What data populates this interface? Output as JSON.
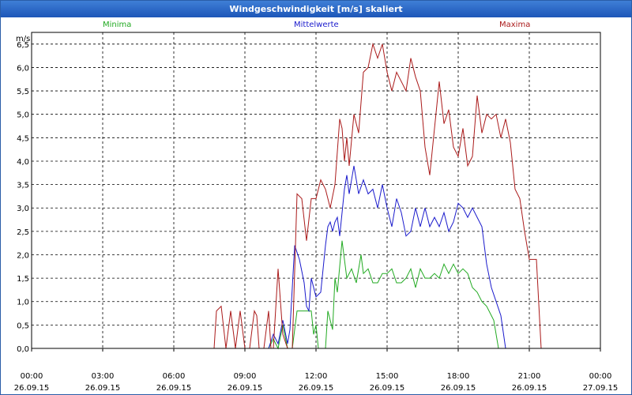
{
  "window": {
    "title": "Windgeschwindigkeit [m/s] skaliert"
  },
  "chart_data": {
    "type": "line",
    "title": "Windgeschwindigkeit [m/s] skaliert",
    "ylabel": "m/s",
    "xlabel": "",
    "ylim": [
      0,
      6.75
    ],
    "xlim": [
      0,
      24
    ],
    "grid": true,
    "legend_position": "top",
    "yticks": [
      "0,0",
      "0,5",
      "1,0",
      "1,5",
      "2,0",
      "2,5",
      "3,0",
      "3,5",
      "4,0",
      "4,5",
      "5,0",
      "5,5",
      "6,0",
      "6,5"
    ],
    "xticks": [
      {
        "time": "00:00",
        "date": "26.09.15"
      },
      {
        "time": "03:00",
        "date": "26.09.15"
      },
      {
        "time": "06:00",
        "date": "26.09.15"
      },
      {
        "time": "09:00",
        "date": "26.09.15"
      },
      {
        "time": "12:00",
        "date": "26.09.15"
      },
      {
        "time": "15:00",
        "date": "26.09.15"
      },
      {
        "time": "18:00",
        "date": "26.09.15"
      },
      {
        "time": "21:00",
        "date": "26.09.15"
      },
      {
        "time": "00:00",
        "date": "27.09.15"
      }
    ],
    "series": [
      {
        "name": "Minima",
        "color": "#22aa22",
        "points": [
          [
            0,
            0
          ],
          [
            10.0,
            0
          ],
          [
            10.2,
            0.2
          ],
          [
            10.4,
            0
          ],
          [
            10.6,
            0.5
          ],
          [
            10.8,
            0
          ],
          [
            11.0,
            0
          ],
          [
            11.2,
            0.8
          ],
          [
            11.5,
            0.8
          ],
          [
            11.8,
            0.8
          ],
          [
            11.9,
            0.3
          ],
          [
            12.0,
            0.5
          ],
          [
            12.1,
            0
          ],
          [
            12.4,
            0
          ],
          [
            12.5,
            0.8
          ],
          [
            12.7,
            0.4
          ],
          [
            12.8,
            1.5
          ],
          [
            12.9,
            1.2
          ],
          [
            13.1,
            2.3
          ],
          [
            13.2,
            1.9
          ],
          [
            13.3,
            1.5
          ],
          [
            13.5,
            1.7
          ],
          [
            13.7,
            1.4
          ],
          [
            13.9,
            2.0
          ],
          [
            14.0,
            1.6
          ],
          [
            14.2,
            1.7
          ],
          [
            14.4,
            1.4
          ],
          [
            14.6,
            1.4
          ],
          [
            14.8,
            1.6
          ],
          [
            15.0,
            1.6
          ],
          [
            15.2,
            1.7
          ],
          [
            15.4,
            1.4
          ],
          [
            15.6,
            1.4
          ],
          [
            15.8,
            1.5
          ],
          [
            16.0,
            1.7
          ],
          [
            16.2,
            1.3
          ],
          [
            16.4,
            1.7
          ],
          [
            16.6,
            1.5
          ],
          [
            16.8,
            1.5
          ],
          [
            17.0,
            1.6
          ],
          [
            17.2,
            1.5
          ],
          [
            17.4,
            1.8
          ],
          [
            17.6,
            1.6
          ],
          [
            17.8,
            1.8
          ],
          [
            18.0,
            1.6
          ],
          [
            18.2,
            1.7
          ],
          [
            18.4,
            1.6
          ],
          [
            18.6,
            1.3
          ],
          [
            18.8,
            1.2
          ],
          [
            19.0,
            1.0
          ],
          [
            19.2,
            0.9
          ],
          [
            19.4,
            0.7
          ],
          [
            19.5,
            0.6
          ],
          [
            19.7,
            0
          ],
          [
            24,
            0
          ]
        ]
      },
      {
        "name": "Mittelwerte",
        "color": "#1a1acc",
        "points": [
          [
            0,
            0
          ],
          [
            10.0,
            0
          ],
          [
            10.2,
            0.3
          ],
          [
            10.4,
            0.1
          ],
          [
            10.6,
            0.6
          ],
          [
            10.8,
            0.1
          ],
          [
            10.9,
            0.4
          ],
          [
            11.1,
            2.2
          ],
          [
            11.3,
            1.9
          ],
          [
            11.5,
            1.4
          ],
          [
            11.6,
            0.9
          ],
          [
            11.7,
            0.8
          ],
          [
            11.8,
            1.5
          ],
          [
            12.0,
            1.1
          ],
          [
            12.2,
            1.2
          ],
          [
            12.4,
            2.2
          ],
          [
            12.5,
            2.6
          ],
          [
            12.6,
            2.7
          ],
          [
            12.7,
            2.5
          ],
          [
            12.8,
            2.7
          ],
          [
            12.9,
            2.8
          ],
          [
            13.0,
            2.4
          ],
          [
            13.2,
            3.4
          ],
          [
            13.3,
            3.7
          ],
          [
            13.4,
            3.3
          ],
          [
            13.6,
            3.9
          ],
          [
            13.8,
            3.3
          ],
          [
            14.0,
            3.6
          ],
          [
            14.2,
            3.3
          ],
          [
            14.4,
            3.4
          ],
          [
            14.6,
            3.0
          ],
          [
            14.8,
            3.5
          ],
          [
            15.0,
            3.0
          ],
          [
            15.2,
            2.6
          ],
          [
            15.4,
            3.2
          ],
          [
            15.6,
            2.9
          ],
          [
            15.8,
            2.4
          ],
          [
            16.0,
            2.5
          ],
          [
            16.2,
            3.0
          ],
          [
            16.4,
            2.6
          ],
          [
            16.6,
            3.0
          ],
          [
            16.8,
            2.6
          ],
          [
            17.0,
            2.8
          ],
          [
            17.2,
            2.6
          ],
          [
            17.4,
            2.9
          ],
          [
            17.6,
            2.5
          ],
          [
            17.8,
            2.7
          ],
          [
            18.0,
            3.1
          ],
          [
            18.2,
            3.0
          ],
          [
            18.4,
            2.8
          ],
          [
            18.6,
            3.0
          ],
          [
            18.8,
            2.8
          ],
          [
            19.0,
            2.6
          ],
          [
            19.2,
            1.8
          ],
          [
            19.4,
            1.3
          ],
          [
            19.6,
            1.0
          ],
          [
            19.8,
            0.7
          ],
          [
            20.0,
            0
          ],
          [
            24,
            0
          ]
        ]
      },
      {
        "name": "Maxima",
        "color": "#aa1a1a",
        "points": [
          [
            0,
            0
          ],
          [
            7.7,
            0
          ],
          [
            7.8,
            0.8
          ],
          [
            8.0,
            0.9
          ],
          [
            8.2,
            0
          ],
          [
            8.4,
            0.8
          ],
          [
            8.6,
            0
          ],
          [
            8.8,
            0.8
          ],
          [
            9.0,
            0
          ],
          [
            9.2,
            0
          ],
          [
            9.4,
            0.8
          ],
          [
            9.5,
            0.7
          ],
          [
            9.6,
            0
          ],
          [
            9.8,
            0
          ],
          [
            10.0,
            0.8
          ],
          [
            10.1,
            0
          ],
          [
            10.2,
            0
          ],
          [
            10.4,
            1.7
          ],
          [
            10.5,
            1.0
          ],
          [
            10.6,
            0.3
          ],
          [
            10.8,
            0
          ],
          [
            11.0,
            0
          ],
          [
            11.2,
            3.3
          ],
          [
            11.4,
            3.2
          ],
          [
            11.6,
            2.3
          ],
          [
            11.8,
            3.2
          ],
          [
            12.0,
            3.2
          ],
          [
            12.2,
            3.6
          ],
          [
            12.4,
            3.4
          ],
          [
            12.6,
            3.0
          ],
          [
            12.8,
            3.5
          ],
          [
            13.0,
            4.9
          ],
          [
            13.1,
            4.7
          ],
          [
            13.2,
            4.0
          ],
          [
            13.3,
            4.5
          ],
          [
            13.4,
            3.9
          ],
          [
            13.6,
            5.0
          ],
          [
            13.8,
            4.6
          ],
          [
            14.0,
            5.9
          ],
          [
            14.2,
            6.0
          ],
          [
            14.4,
            6.5
          ],
          [
            14.6,
            6.2
          ],
          [
            14.8,
            6.5
          ],
          [
            15.0,
            5.9
          ],
          [
            15.2,
            5.5
          ],
          [
            15.4,
            5.9
          ],
          [
            15.6,
            5.7
          ],
          [
            15.8,
            5.5
          ],
          [
            16.0,
            6.2
          ],
          [
            16.2,
            5.8
          ],
          [
            16.4,
            5.5
          ],
          [
            16.6,
            4.3
          ],
          [
            16.8,
            3.7
          ],
          [
            17.0,
            4.7
          ],
          [
            17.2,
            5.7
          ],
          [
            17.4,
            4.8
          ],
          [
            17.6,
            5.1
          ],
          [
            17.8,
            4.3
          ],
          [
            18.0,
            4.1
          ],
          [
            18.2,
            4.7
          ],
          [
            18.4,
            3.9
          ],
          [
            18.6,
            4.1
          ],
          [
            18.8,
            5.4
          ],
          [
            19.0,
            4.6
          ],
          [
            19.2,
            5.0
          ],
          [
            19.4,
            4.9
          ],
          [
            19.6,
            5.0
          ],
          [
            19.8,
            4.5
          ],
          [
            20.0,
            4.9
          ],
          [
            20.2,
            4.4
          ],
          [
            20.4,
            3.4
          ],
          [
            20.6,
            3.2
          ],
          [
            20.8,
            2.5
          ],
          [
            21.0,
            1.9
          ],
          [
            21.3,
            1.9
          ],
          [
            21.5,
            0
          ],
          [
            24,
            0
          ]
        ]
      }
    ]
  }
}
